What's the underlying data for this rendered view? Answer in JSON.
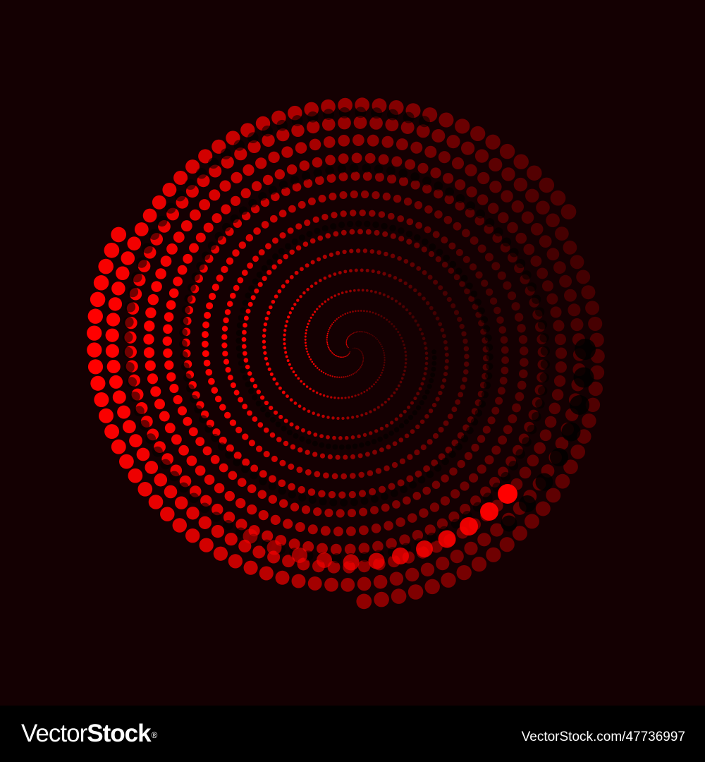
{
  "artwork": {
    "subject": "red-dotted-spiral",
    "background_color": "#140002",
    "dot_color": "#ff0000",
    "dark_dot_color": "#000000"
  },
  "footer": {
    "brand_regular": "Vector",
    "brand_bold": "Stock",
    "brand_mark": "®",
    "image_id": "VectorStock.com/47736997",
    "background_color": "#000000",
    "text_color": "#ffffff"
  }
}
